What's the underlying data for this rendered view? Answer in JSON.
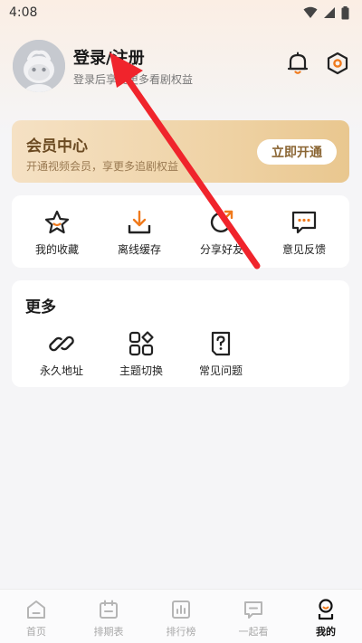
{
  "status_bar": {
    "time": "4:08"
  },
  "header": {
    "login_title": "登录/注册",
    "login_subtitle": "登录后享受更多看剧权益"
  },
  "vip": {
    "title": "会员中心",
    "subtitle": "开通视频会员，享更多追剧权益",
    "button": "立即开通"
  },
  "quick_actions": [
    {
      "label": "我的收藏",
      "icon": "star-icon"
    },
    {
      "label": "离线缓存",
      "icon": "download-icon"
    },
    {
      "label": "分享好友",
      "icon": "share-icon"
    },
    {
      "label": "意见反馈",
      "icon": "feedback-icon"
    }
  ],
  "more": {
    "title": "更多",
    "items": [
      {
        "label": "永久地址",
        "icon": "link-icon"
      },
      {
        "label": "主题切换",
        "icon": "theme-icon"
      },
      {
        "label": "常见问题",
        "icon": "faq-icon"
      }
    ]
  },
  "tabbar": {
    "items": [
      {
        "label": "首页",
        "icon": "home-icon"
      },
      {
        "label": "排期表",
        "icon": "calendar-icon"
      },
      {
        "label": "排行榜",
        "icon": "ranking-icon"
      },
      {
        "label": "一起看",
        "icon": "watch-together-icon"
      },
      {
        "label": "我的",
        "icon": "profile-icon"
      }
    ],
    "active_index": 4
  },
  "colors": {
    "accent": "#f07a1c",
    "vip_text": "#6b4a22",
    "arrow": "#f0242c"
  }
}
